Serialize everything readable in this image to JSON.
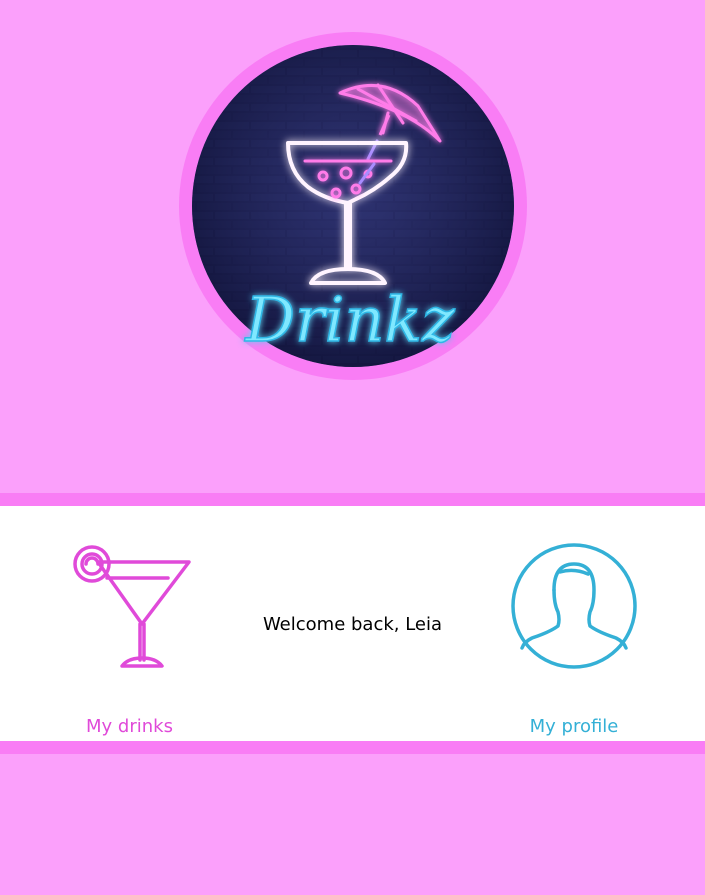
{
  "app": {
    "logo_text": "Drinkz"
  },
  "nav": {
    "drinks_label": "My drinks",
    "profile_label": "My profile"
  },
  "welcome": {
    "text": "Welcome back, Leia"
  },
  "icons": {
    "logo": "neon-cocktail-logo",
    "drinks": "martini-glass-icon",
    "profile": "user-silhouette-icon"
  },
  "colors": {
    "background": "#fba0fb",
    "stripe": "#f97df5",
    "panel": "#ffffff",
    "drinks_accent": "#e04ad9",
    "profile_accent": "#34b0d6",
    "logo_ring": "#f97df5",
    "logo_bg": "#1c1f52"
  }
}
